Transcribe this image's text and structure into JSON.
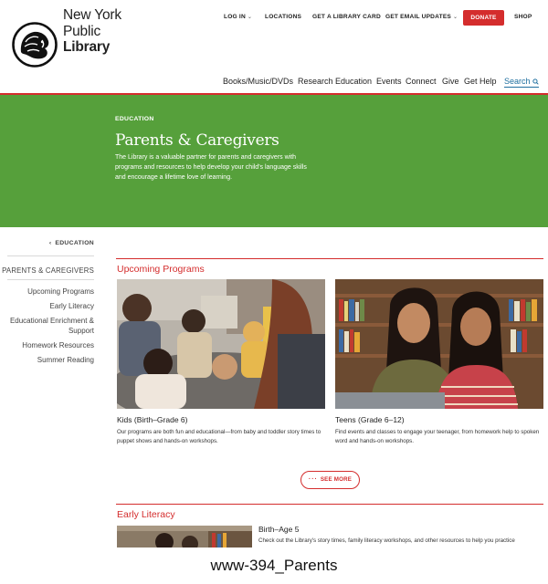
{
  "logo": {
    "line1": "New York",
    "line2": "Public",
    "line3": "Library"
  },
  "utility_nav": {
    "login": "LOG IN",
    "locations": "LOCATIONS",
    "library_card": "GET A LIBRARY CARD",
    "email_updates": "GET EMAIL UPDATES",
    "donate": "DONATE",
    "shop": "SHOP"
  },
  "main_nav": {
    "items": [
      "Books/Music/DVDs",
      "Research",
      "Education",
      "Events",
      "Connect",
      "Give",
      "Get Help"
    ],
    "search": "Search"
  },
  "hero": {
    "eyebrow": "EDUCATION",
    "title": "Parents & Caregivers",
    "description": "The Library is a valuable partner for parents and caregivers with programs and resources to help develop your child's language skills and encourage a lifetime love of learning.",
    "bg_color": "#56a03b"
  },
  "sidebar": {
    "back": "EDUCATION",
    "heading": "PARENTS & CAREGIVERS",
    "items": [
      "Upcoming Programs",
      "Early Literacy",
      "Educational Enrichment & Support",
      "Homework Resources",
      "Summer Reading"
    ]
  },
  "upcoming": {
    "title": "Upcoming Programs",
    "cards": [
      {
        "title": "Kids (Birth–Grade 6)",
        "description": "Our programs are both fun and educational—from baby and toddler story times to puppet shows and hands-on workshops."
      },
      {
        "title": "Teens (Grade 6–12)",
        "description": "Find events and classes to engage your teenager, from homework help to spoken word and hands-on workshops."
      }
    ],
    "see_more": "SEE MORE"
  },
  "early_literacy": {
    "title": "Early Literacy",
    "card_title": "Birth–Age 5",
    "card_description": "Check out the Library's story times, family literacy workshops, and other resources to help you practice"
  },
  "caption": "www-394_Parents",
  "colors": {
    "accent_red": "#d42d2d",
    "link_blue": "#1f6f9f"
  },
  "icons": [
    "lion-logo-icon",
    "chevron-down-icon",
    "search-icon",
    "chevron-left-icon",
    "ellipsis-icon"
  ]
}
